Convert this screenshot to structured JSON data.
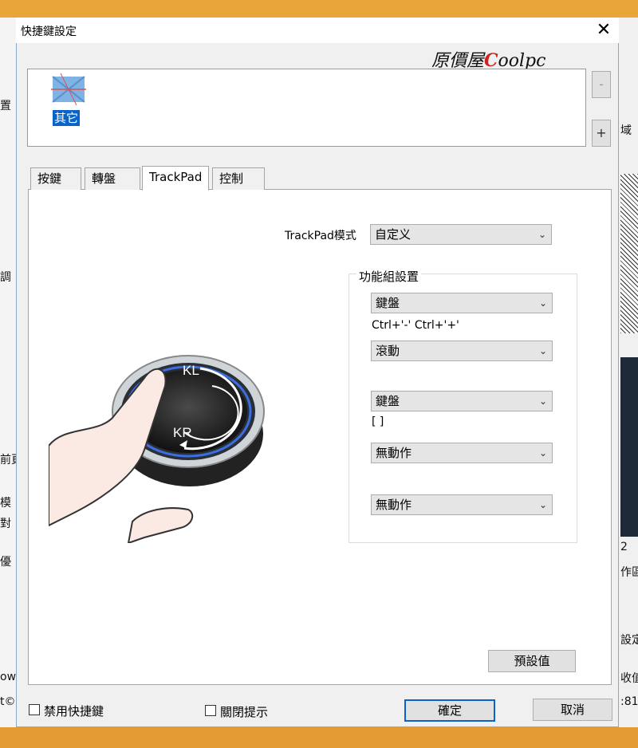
{
  "background": {
    "left_fragments": [
      "置",
      "調",
      "前頁",
      "模",
      "對",
      "優",
      "ow",
      "t©"
    ],
    "right_fragments": [
      "域",
      "2",
      "作區",
      "設定",
      "收值",
      ":81"
    ]
  },
  "dialog": {
    "title": "快捷鍵設定",
    "brand_prefix": "原價屋",
    "brand_c": "C",
    "brand_suffix": "oolpc",
    "app_icon_label": "其它",
    "minus_label": "-",
    "plus_label": "+"
  },
  "tabs": [
    {
      "label": "按鍵"
    },
    {
      "label": "轉盤"
    },
    {
      "label": "TrackPad"
    },
    {
      "label": "控制"
    }
  ],
  "trackpad": {
    "mode_label": "TrackPad模式",
    "mode_value": "自定义",
    "group_title": "功能組設置",
    "functions": [
      {
        "value": "鍵盤",
        "note": "Ctrl+'-'  Ctrl+'+'"
      },
      {
        "value": "滾動",
        "note": ""
      },
      {
        "value": "鍵盤",
        "note": "[ ]"
      },
      {
        "value": "無動作",
        "note": ""
      },
      {
        "value": "無動作",
        "note": ""
      }
    ],
    "illustration": {
      "kl": "KL",
      "kr": "KR"
    },
    "default_button": "預設值"
  },
  "footer": {
    "disable_shortcuts": "禁用快捷鍵",
    "close_tips": "關閉提示",
    "ok": "確定",
    "cancel": "取消"
  },
  "icons": {
    "arrow": "chevron-down-icon",
    "close": "close-icon"
  },
  "colors": {
    "selection": "#0a64c8",
    "brand_red": "#c22222"
  }
}
